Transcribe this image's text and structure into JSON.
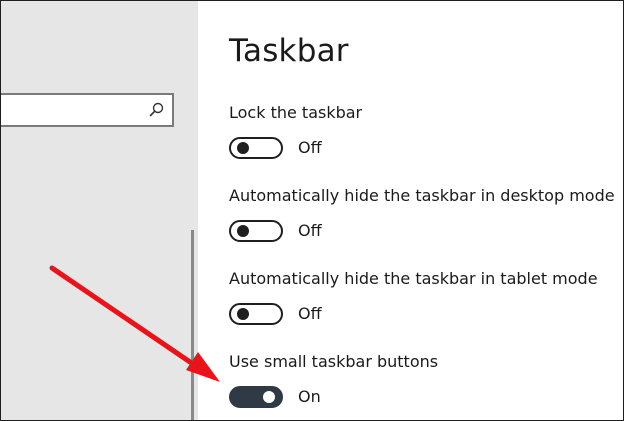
{
  "page": {
    "title": "Taskbar"
  },
  "search": {
    "icon": "search-icon"
  },
  "settings": [
    {
      "label": "Lock the taskbar",
      "state": "Off",
      "on": false
    },
    {
      "label": "Automatically hide the taskbar in desktop mode",
      "state": "Off",
      "on": false
    },
    {
      "label": "Automatically hide the taskbar in tablet mode",
      "state": "Off",
      "on": false
    },
    {
      "label": "Use small taskbar buttons",
      "state": "On",
      "on": true
    }
  ],
  "colors": {
    "toggle_on_fill": "#2f3a44",
    "annotation_arrow": "#e8141a",
    "left_pane_bg": "#e6e6e6"
  }
}
